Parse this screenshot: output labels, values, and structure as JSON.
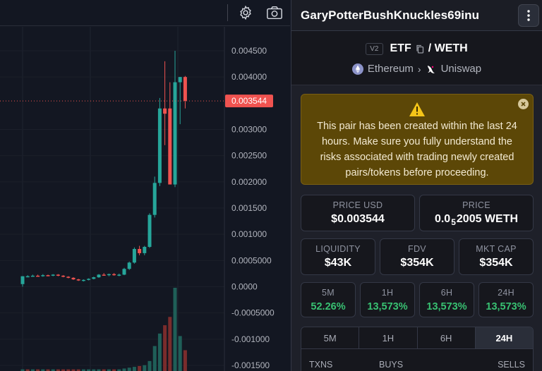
{
  "chart": {
    "price_axis_labels": [
      "0.004500",
      "0.004000",
      "0.003000",
      "0.002500",
      "0.002000",
      "0.001500",
      "0.001000",
      "0.0005000",
      "0.0000",
      "-0.0005000",
      "-0.001000",
      "-0.001500"
    ],
    "current_price_tag": "0.003544",
    "colors": {
      "up": "#26a69a",
      "down": "#ef5350",
      "tag": "#f05350"
    }
  },
  "chart_data": {
    "type": "candlestick",
    "ylim": [
      -0.0015,
      0.0046
    ],
    "last_price": 0.003544,
    "candles": [
      {
        "o": 5e-05,
        "h": 0.0002,
        "l": 0.0,
        "c": 0.0002
      },
      {
        "o": 0.0002,
        "h": 0.00022,
        "l": 0.00018,
        "c": 0.0002
      },
      {
        "o": 0.0002,
        "h": 0.00023,
        "l": 0.00019,
        "c": 0.00021
      },
      {
        "o": 0.00021,
        "h": 0.00023,
        "l": 0.0002,
        "c": 0.0002
      },
      {
        "o": 0.0002,
        "h": 0.00024,
        "l": 0.00019,
        "c": 0.00022
      },
      {
        "o": 0.00022,
        "h": 0.00023,
        "l": 0.0002,
        "c": 0.00021
      },
      {
        "o": 0.00021,
        "h": 0.00024,
        "l": 0.0002,
        "c": 0.00023
      },
      {
        "o": 0.00023,
        "h": 0.00024,
        "l": 0.0002,
        "c": 0.00021
      },
      {
        "o": 0.00021,
        "h": 0.00022,
        "l": 0.00018,
        "c": 0.00019
      },
      {
        "o": 0.00019,
        "h": 0.0002,
        "l": 0.00016,
        "c": 0.00017
      },
      {
        "o": 0.00017,
        "h": 0.00018,
        "l": 0.00013,
        "c": 0.00014
      },
      {
        "o": 0.00014,
        "h": 0.00015,
        "l": 0.00011,
        "c": 0.00012
      },
      {
        "o": 0.00012,
        "h": 0.00014,
        "l": 0.0001,
        "c": 0.00013
      },
      {
        "o": 0.00013,
        "h": 0.00016,
        "l": 0.00012,
        "c": 0.00015
      },
      {
        "o": 0.00015,
        "h": 0.00019,
        "l": 0.00014,
        "c": 0.00018
      },
      {
        "o": 0.00018,
        "h": 0.00024,
        "l": 0.00017,
        "c": 0.00023
      },
      {
        "o": 0.00023,
        "h": 0.00026,
        "l": 0.00021,
        "c": 0.00022
      },
      {
        "o": 0.00022,
        "h": 0.00025,
        "l": 0.0002,
        "c": 0.00024
      },
      {
        "o": 0.00024,
        "h": 0.00026,
        "l": 0.00021,
        "c": 0.00022
      },
      {
        "o": 0.00022,
        "h": 0.00025,
        "l": 0.0002,
        "c": 0.00023
      },
      {
        "o": 0.00023,
        "h": 0.00036,
        "l": 0.00022,
        "c": 0.00034
      },
      {
        "o": 0.00034,
        "h": 0.00048,
        "l": 0.00032,
        "c": 0.00046
      },
      {
        "o": 0.00046,
        "h": 0.00075,
        "l": 0.00044,
        "c": 0.00072
      },
      {
        "o": 0.00072,
        "h": 0.00078,
        "l": 0.0006,
        "c": 0.00064
      },
      {
        "o": 0.00064,
        "h": 0.00078,
        "l": 0.0006,
        "c": 0.00076
      },
      {
        "o": 0.00076,
        "h": 0.0014,
        "l": 0.00074,
        "c": 0.00137
      },
      {
        "o": 0.00137,
        "h": 0.0021,
        "l": 0.00132,
        "c": 0.00198
      },
      {
        "o": 0.00198,
        "h": 0.0036,
        "l": 0.00192,
        "c": 0.0034
      },
      {
        "o": 0.0034,
        "h": 0.0043,
        "l": 0.0027,
        "c": 0.0033
      },
      {
        "o": 0.0034,
        "h": 0.0039,
        "l": 0.00195,
        "c": 0.00195
      },
      {
        "o": 0.00195,
        "h": 0.0045,
        "l": 0.0019,
        "c": 0.0039
      },
      {
        "o": 0.0039,
        "h": 0.004,
        "l": 0.0031,
        "c": 0.004
      },
      {
        "o": 0.004,
        "h": 0.00402,
        "l": 0.0034,
        "c": 0.003544
      }
    ],
    "volumes": [
      0.02,
      0.02,
      0.02,
      0.02,
      0.02,
      0.02,
      0.02,
      0.02,
      0.02,
      0.02,
      0.02,
      0.02,
      0.02,
      0.02,
      0.02,
      0.02,
      0.02,
      0.02,
      0.02,
      0.02,
      0.03,
      0.04,
      0.05,
      0.06,
      0.07,
      0.12,
      0.3,
      0.45,
      0.55,
      0.65,
      1.0,
      0.42,
      0.25
    ],
    "volume_dirs": [
      "u",
      "d",
      "u",
      "d",
      "u",
      "d",
      "u",
      "d",
      "d",
      "d",
      "d",
      "d",
      "u",
      "u",
      "u",
      "u",
      "d",
      "u",
      "d",
      "u",
      "u",
      "u",
      "u",
      "d",
      "u",
      "u",
      "u",
      "u",
      "d",
      "d",
      "u",
      "u",
      "d"
    ]
  },
  "toolbar": {
    "settings_icon": "gear-icon",
    "screenshot_icon": "camera-icon"
  },
  "pair": {
    "title": "GaryPotterBushKnuckles69inu",
    "version": "V2",
    "base": "ETF",
    "separator": "/ WETH",
    "chain": "Ethereum",
    "dex": "Uniswap"
  },
  "warning": {
    "text": "This pair has been created within the last 24 hours. Make sure you fully understand the risks associated with trading newly created pairs/tokens before proceeding."
  },
  "stats": {
    "price_usd_label": "PRICE USD",
    "price_usd": "$0.003544",
    "price_label": "PRICE",
    "price_weth_prefix": "0.0",
    "price_weth_sub": "5",
    "price_weth_rest": "2005 WETH",
    "liquidity_label": "LIQUIDITY",
    "liquidity": "$43K",
    "fdv_label": "FDV",
    "fdv": "$354K",
    "mktcap_label": "MKT CAP",
    "mktcap": "$354K"
  },
  "changes": [
    {
      "label": "5M",
      "value": "52.26%"
    },
    {
      "label": "1H",
      "value": "13,573%"
    },
    {
      "label": "6H",
      "value": "13,573%"
    },
    {
      "label": "24H",
      "value": "13,573%"
    }
  ],
  "tabs": [
    {
      "label": "5M",
      "active": false
    },
    {
      "label": "1H",
      "active": false
    },
    {
      "label": "6H",
      "active": false
    },
    {
      "label": "24H",
      "active": true
    }
  ],
  "txns": {
    "txns_label": "TXNS",
    "buys_label": "BUYS",
    "sells_label": "SELLS"
  }
}
